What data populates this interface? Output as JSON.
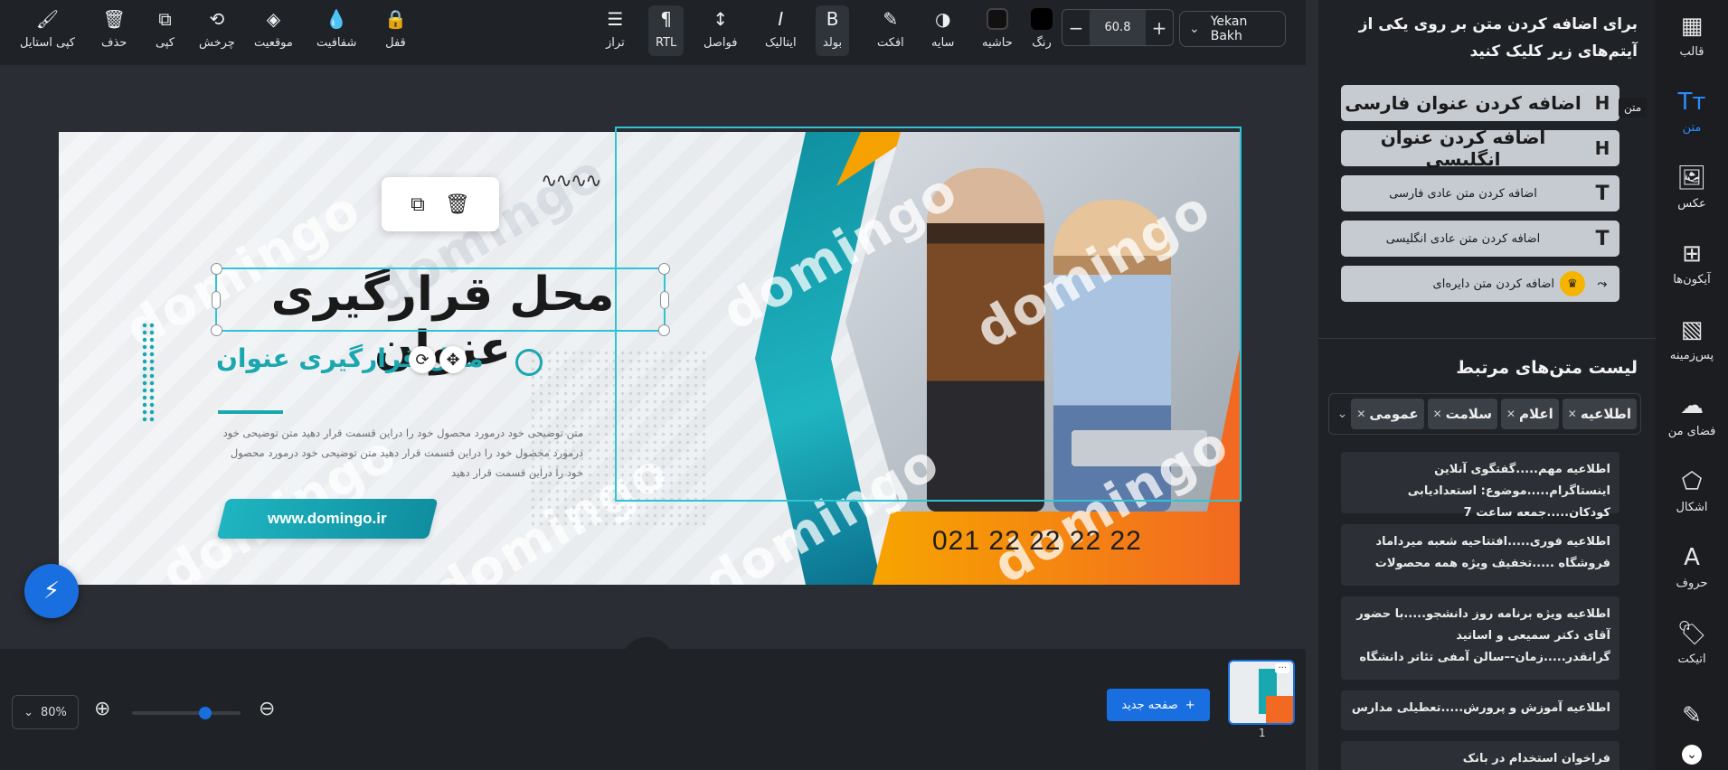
{
  "toolbar": {
    "items": [
      {
        "label": "کپی استایل",
        "icon": "brush-icon"
      },
      {
        "label": "حذف",
        "icon": "trash-icon"
      },
      {
        "label": "کپی",
        "icon": "copy-icon"
      },
      {
        "label": "چرخش",
        "icon": "rotate-icon"
      },
      {
        "label": "موقعیت",
        "icon": "layers-icon"
      },
      {
        "label": "شفافیت",
        "icon": "drop-icon"
      },
      {
        "label": "قفل",
        "icon": "lock-icon"
      },
      {
        "label": "تراز",
        "icon": "align-icon"
      },
      {
        "label": "RTL",
        "icon": "paragraph-icon"
      },
      {
        "label": "فواصل",
        "icon": "spacing-icon"
      },
      {
        "label": "ایتالیک",
        "icon": "italic-icon"
      },
      {
        "label": "بولد",
        "icon": "bold-icon"
      },
      {
        "label": "افکت",
        "icon": "effect-icon"
      },
      {
        "label": "سایه",
        "icon": "shadow-icon"
      },
      {
        "label": "حاشیه",
        "icon": "border-icon"
      },
      {
        "label": "رنگ",
        "icon": "color-icon"
      }
    ],
    "font_size": "60.8",
    "font_name": "Yekan Bakh",
    "minus": "−",
    "plus": "+"
  },
  "banner": {
    "title_main": "محل قرارگیری عنوان",
    "title_sub": "محل قرارگیری عنوان",
    "description": "متن توضیحی خود درمورد محصول خود را دراین قسمت قرار دهید  متن توضیحی خود درمورد محصول خود را دراین قسمت قرار دهید متن توضیحی خود درمورد محصول خود را دراین قسمت قرار دهید",
    "url": "www.domingo.ir",
    "phone": "021 22 22 22 22",
    "watermark": "domingo"
  },
  "bottom": {
    "zoom": "80%",
    "zoom_level": 0.7,
    "new_page": "صفحه جدید",
    "page_number": "1"
  },
  "panel": {
    "header": "برای اضافه کردن متن بر روی یکی از آیتم‌های زیر کلیک کنید",
    "tooltip": "متن",
    "add_buttons": [
      {
        "label": "اضافه کردن عنوان فارسی",
        "icon_text": "H"
      },
      {
        "label": "اضافه کردن عنوان انگلیسی",
        "icon_text": "H"
      },
      {
        "label": "اضافه کردن متن عادی فارسی",
        "icon_text": "T"
      },
      {
        "label": "اضافه کردن متن عادی انگلیسی",
        "icon_text": "T"
      },
      {
        "label": "اضافه کردن متن دایره‌ای",
        "icon_text": "⤳"
      }
    ],
    "related_title": "لیست متن‌های مرتبط",
    "tags": [
      "اطلاعیه",
      "اعلام",
      "سلامت",
      "عمومی"
    ],
    "related_items": [
      "اطلاعیه مهم.....گفتگوی آنلاین اینستاگرام.....موضوع: استعدادیابی کودکان.....جمعه ساعت 7",
      "اطلاعیه فوری.....افتتاحیه شعبه میرداماد فروشگاه .....تخفیف ویژه همه محصولات",
      "اطلاعیه ویژه برنامه روز دانشجو.....با حضور آقای دکتر سمیعی و اساتید گرانقدر.....زمان-–سالن آمفی تئاتر دانشگاه",
      "اطلاعیه آموزش و پرورش.....تعطیلی مدارس",
      "فراخوان استخدام در بانک"
    ]
  },
  "rail": [
    {
      "label": "قالب",
      "icon": "template-icon"
    },
    {
      "label": "متن",
      "icon": "text-icon"
    },
    {
      "label": "عکس",
      "icon": "image-icon"
    },
    {
      "label": "آیکون‌ها",
      "icon": "grid-icon"
    },
    {
      "label": "پس‌زمینه",
      "icon": "background-icon"
    },
    {
      "label": "فضای من",
      "icon": "cloud-upload-icon"
    },
    {
      "label": "اشکال",
      "icon": "shapes-icon"
    },
    {
      "label": "حروف",
      "icon": "letters-icon"
    },
    {
      "label": "اتیکت",
      "icon": "tag-icon"
    },
    {
      "label": "",
      "icon": "pen-icon"
    }
  ],
  "colors": {
    "accent": "#1a6fe0",
    "teal": "#19a7b0",
    "orange": "#f26a21",
    "toolbar_bg": "#1f2227"
  }
}
